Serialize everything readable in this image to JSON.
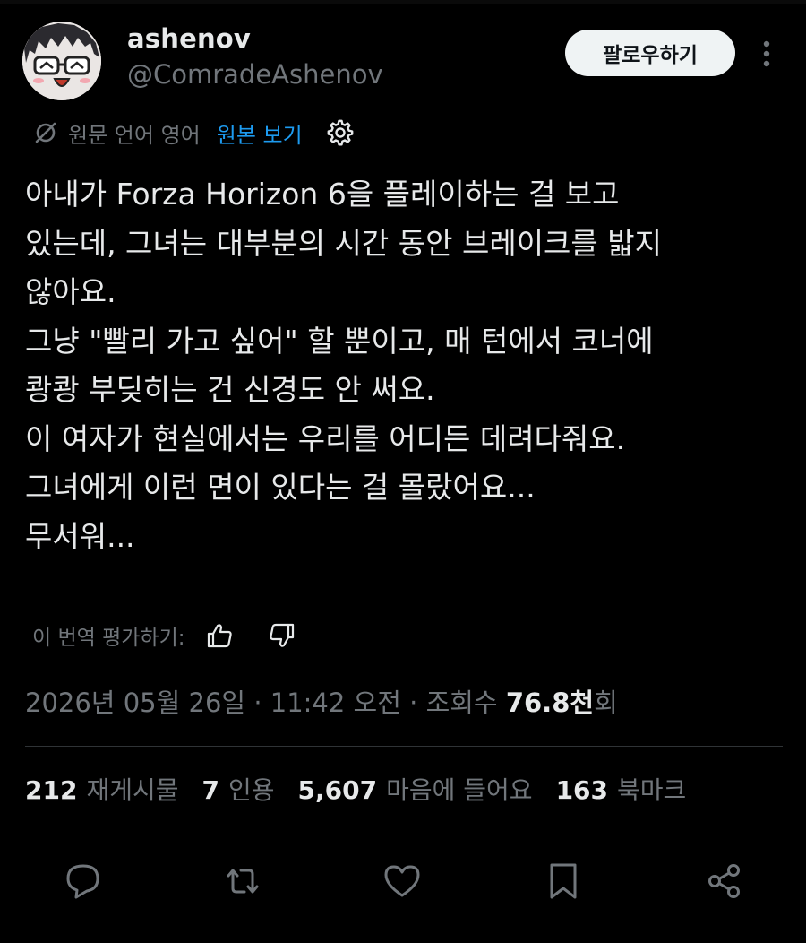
{
  "author": {
    "display_name": "ashenov",
    "handle": "@ComradeAshenov"
  },
  "follow_button_label": "팔로우하기",
  "translation": {
    "source_language_label": "원문 언어 영어",
    "show_original_label": "원본 보기"
  },
  "tweet": {
    "lines": [
      "아내가 Forza Horizon 6을 플레이하는 걸 보고",
      "있는데, 그녀는 대부분의 시간 동안 브레이크를 밟지",
      "않아요.",
      "그냥 \"빨리 가고 싶어\" 할 뿐이고, 매 턴에서 코너에",
      "쾅쾅 부딪히는 건 신경도 안 써요.",
      "이 여자가 현실에서는 우리를 어디든 데려다줘요.",
      "그녀에게 이런 면이 있다는 걸 몰랐어요...",
      "무서워..."
    ]
  },
  "rate_translation_label": "이 번역 평가하기:",
  "meta": {
    "date": "2026년 05월 26일",
    "separator": "·",
    "time": "11:42 오전",
    "views_label": "조회수",
    "views_count": "76.8천",
    "views_suffix": "회"
  },
  "stats": [
    {
      "count": "212",
      "label": "재게시물"
    },
    {
      "count": "7",
      "label": "인용"
    },
    {
      "count": "5,607",
      "label": "마음에 들어요"
    },
    {
      "count": "163",
      "label": "북마크"
    }
  ],
  "actions": [
    "reply-icon",
    "repost-icon",
    "like-icon",
    "bookmark-icon",
    "share-icon"
  ],
  "colors": {
    "background": "#000000",
    "primary_text": "#e7e9ea",
    "secondary_text": "#71767b",
    "link": "#1d9bf0",
    "follow_button_bg": "#eff3f4",
    "divider": "#2f3336"
  }
}
